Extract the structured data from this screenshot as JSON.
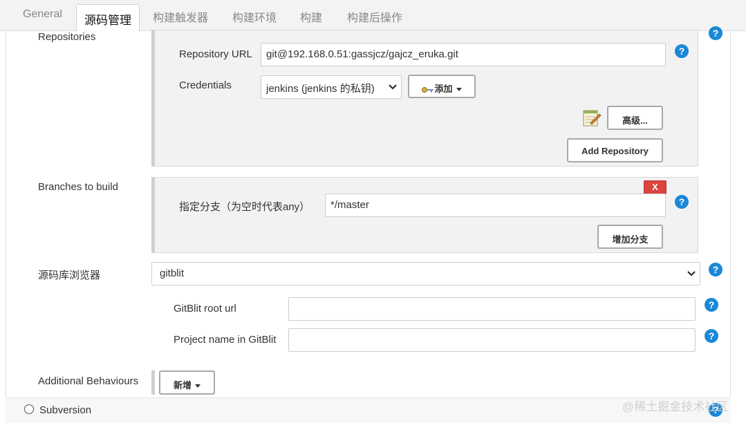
{
  "tabs": [
    {
      "label": "General"
    },
    {
      "label": "源码管理"
    },
    {
      "label": "构建触发器"
    },
    {
      "label": "构建环境"
    },
    {
      "label": "构建"
    },
    {
      "label": "构建后操作"
    }
  ],
  "repositories": {
    "section_label": "Repositories",
    "url_label": "Repository URL",
    "url_value": "git@192.168.0.51:gassjcz/gajcz_eruka.git",
    "credentials_label": "Credentials",
    "credentials_value": "jenkins (jenkins 的私钥)",
    "add_credentials_label": "添加",
    "advanced_label": "高级...",
    "add_repository_label": "Add Repository"
  },
  "branches": {
    "section_label": "Branches to build",
    "remove_label": "X",
    "specifier_label": "指定分支（为空时代表any）",
    "specifier_value": "*/master",
    "add_branch_label": "增加分支"
  },
  "browser": {
    "label": "源码库浏览器",
    "value": "gitblit",
    "root_url_label": "GitBlit root url",
    "root_url_value": "",
    "project_name_label": "Project name in GitBlit",
    "project_name_value": ""
  },
  "behaviours": {
    "label": "Additional Behaviours",
    "add_label": "新增"
  },
  "scm_options": {
    "subversion_label": "Subversion"
  },
  "help_glyph": "?",
  "watermark": "@稀土掘金技术社区",
  "colors": {
    "help": "#1a88d6",
    "remove": "#d9443c",
    "section_bg": "#f2f2f2"
  }
}
